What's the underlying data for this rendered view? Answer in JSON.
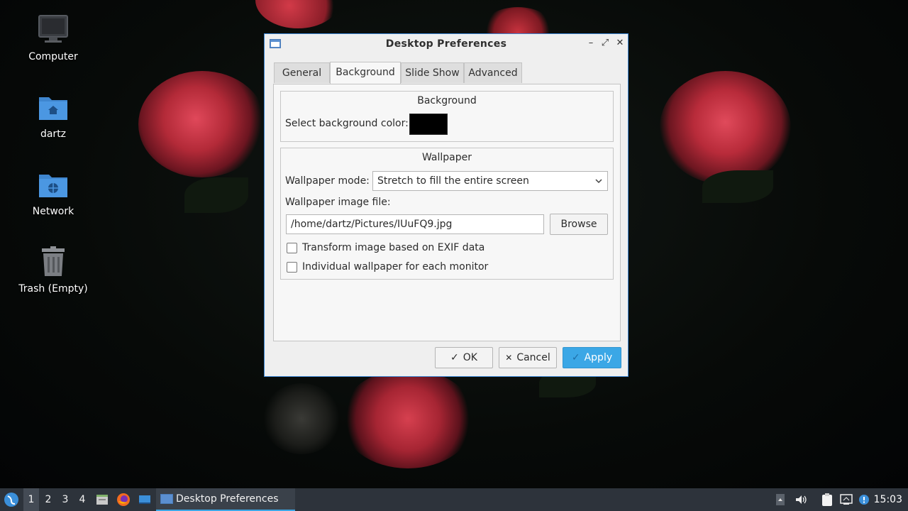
{
  "desktop": {
    "icons": [
      {
        "label": "Computer",
        "icon": "computer-icon"
      },
      {
        "label": "dartz",
        "icon": "home-folder-icon"
      },
      {
        "label": "Network",
        "icon": "network-folder-icon"
      },
      {
        "label": "Trash (Empty)",
        "icon": "trash-icon"
      }
    ]
  },
  "dialog": {
    "title": "Desktop Preferences",
    "controls": {
      "minimize": "–",
      "maximize": "⤢",
      "close": "✕"
    },
    "tabs": [
      {
        "label": "General",
        "active": false
      },
      {
        "label": "Background",
        "active": true
      },
      {
        "label": "Slide Show",
        "active": false
      },
      {
        "label": "Advanced",
        "active": false
      }
    ],
    "background_group": {
      "title": "Background",
      "color_label": "Select background color:",
      "color_value": "#000000"
    },
    "wallpaper_group": {
      "title": "Wallpaper",
      "mode_label": "Wallpaper mode:",
      "mode_value": "Stretch to fill the entire screen",
      "file_label": "Wallpaper image file:",
      "file_value": "/home/dartz/Pictures/IUuFQ9.jpg",
      "browse_label": "Browse",
      "exif_label": "Transform image based on EXIF data",
      "exif_checked": false,
      "per_monitor_label": "Individual wallpaper for each monitor",
      "per_monitor_checked": false
    },
    "buttons": {
      "ok": "OK",
      "cancel": "Cancel",
      "apply": "Apply"
    }
  },
  "taskbar": {
    "workspaces": [
      "1",
      "2",
      "3",
      "4"
    ],
    "active_workspace": "1",
    "task_label": "Desktop Preferences",
    "clock": "15:03"
  },
  "colors": {
    "accent": "#3ba7e6",
    "dialog_border": "#3d88d6",
    "taskbar": "#2d333b",
    "rose": "#c0303d"
  }
}
